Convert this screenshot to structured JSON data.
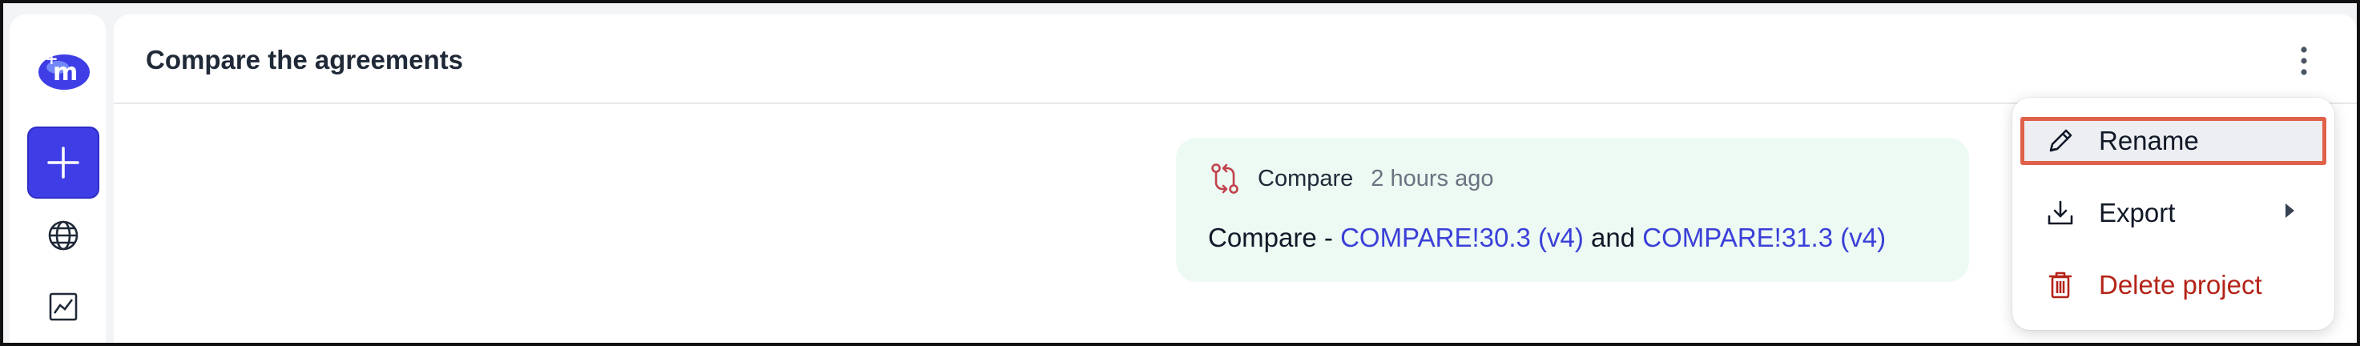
{
  "app": {
    "logo_icon": "brand-logo-icon"
  },
  "sidebar": {
    "new_button_icon": "plus-icon",
    "items": [
      {
        "icon": "globe-icon"
      },
      {
        "icon": "chart-line-icon"
      }
    ]
  },
  "header": {
    "title": "Compare the agreements",
    "menu_icon": "more-vertical-icon"
  },
  "message": {
    "icon": "compare-icon",
    "type": "Compare",
    "time": "2 hours ago",
    "prefix": "Compare - ",
    "link_a": "COMPARE!30.3 (v4)",
    "conjunction": " and ",
    "link_b": "COMPARE!31.3 (v4)",
    "bubble_color": "#ecfaf3",
    "link_color": "#3b3fd8"
  },
  "menu": {
    "items": [
      {
        "label": "Rename",
        "icon": "pencil-icon",
        "highlighted": true
      },
      {
        "label": "Export",
        "icon": "download-icon",
        "has_submenu": true
      },
      {
        "label": "Delete project",
        "icon": "trash-icon",
        "danger": true,
        "color": "#b42318"
      }
    ]
  },
  "colors": {
    "accent": "#3f3ee6",
    "highlight_border": "#e0614a",
    "danger": "#b42318"
  }
}
